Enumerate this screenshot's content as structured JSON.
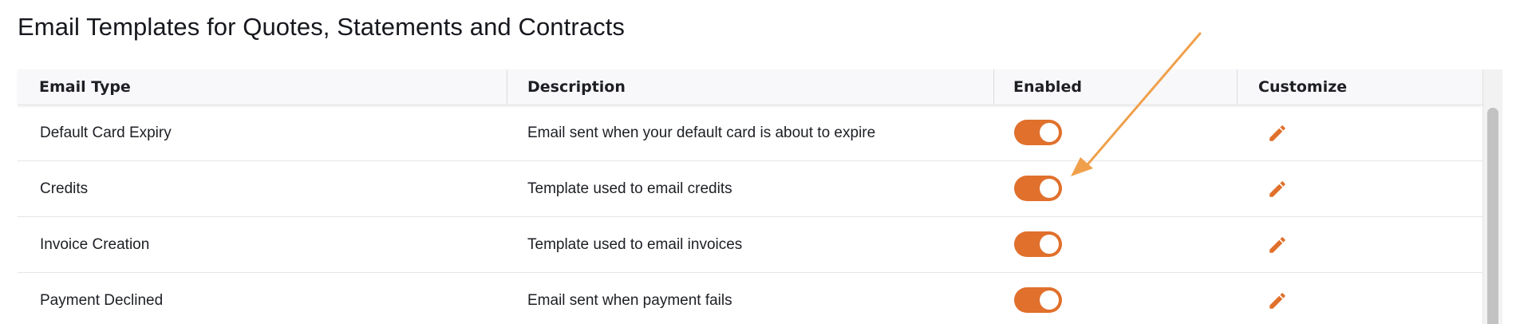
{
  "page": {
    "title": "Email Templates for Quotes, Statements and Contracts"
  },
  "table": {
    "headers": {
      "email_type": "Email Type",
      "description": "Description",
      "enabled": "Enabled",
      "customize": "Customize"
    },
    "rows": [
      {
        "email_type": "Default Card Expiry",
        "description": "Email sent when your default card is about to expire",
        "enabled": true
      },
      {
        "email_type": "Credits",
        "description": "Template used to email credits",
        "enabled": true
      },
      {
        "email_type": "Invoice Creation",
        "description": "Template used to email invoices",
        "enabled": true
      },
      {
        "email_type": "Payment Declined",
        "description": "Email sent when payment fails",
        "enabled": true
      }
    ]
  },
  "icons": {
    "customize": "pencil-icon"
  },
  "colors": {
    "accent": "#e0702c",
    "annotation_arrow": "#f0a04b",
    "header_bg": "#f8f8fa"
  }
}
